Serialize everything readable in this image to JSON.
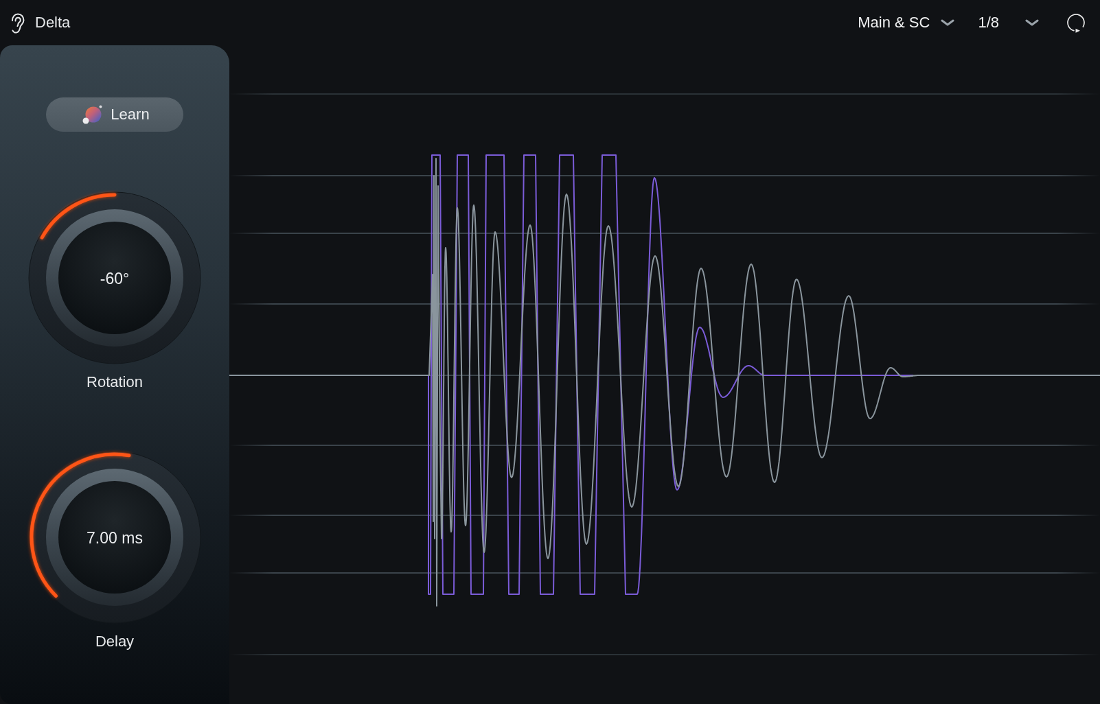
{
  "header": {
    "title": "Delta",
    "menus": [
      {
        "label": "Main & SC"
      },
      {
        "label": "1/8"
      }
    ]
  },
  "panel": {
    "learn_button": {
      "label": "Learn"
    },
    "knobs": [
      {
        "kind": "bipolar",
        "value": "-60°",
        "label": "Rotation",
        "level": 0.274
      },
      {
        "kind": "unipolar",
        "value": "7.00 ms",
        "label": "Delay",
        "level": 0.537
      }
    ]
  }
}
